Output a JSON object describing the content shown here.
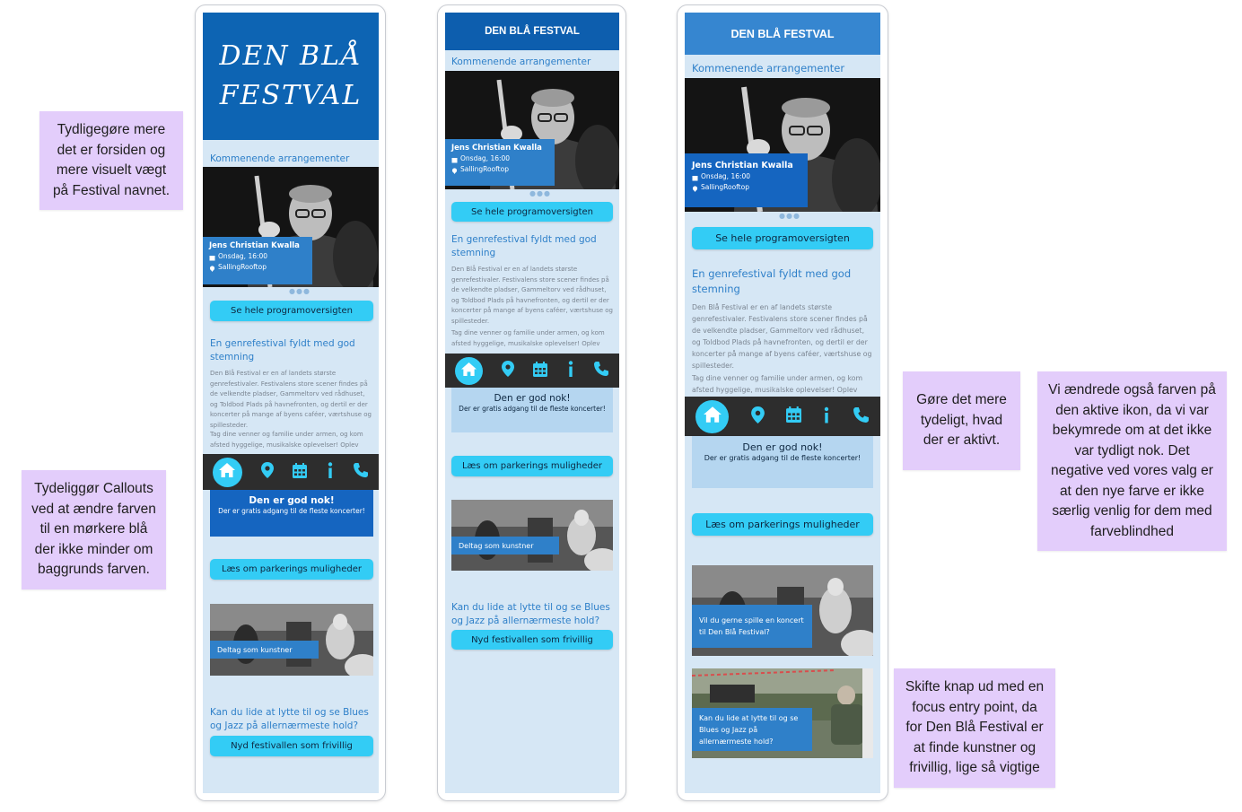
{
  "colors": {
    "header_v1": "#0d64b3",
    "header_v2": "#0d5eae",
    "header_v3": "#3686d0",
    "screen_bg": "#d6e7f5",
    "button": "#33ccf5",
    "callout_dark": "#1565c0",
    "callout_light": "#b5d6f0",
    "nav_bg": "#2d2d2d",
    "nav_icon": "#33ccf5",
    "note_bg": "#e3cdfb"
  },
  "notes": {
    "note1": "Tydligegøre mere det er forsiden og mere visuelt vægt på Festival navnet.",
    "note2": "Tydeliggør Callouts ved at ændre farven til en mørkere blå der ikke minder om baggrunds farven.",
    "note3": "Gøre det mere tydeligt, hvad der er aktivt.",
    "note4": "Vi ændrede også farven på den aktive ikon, da vi var bekymrede om at det ikke var tydligt nok. Det negative ved vores valg er at den nye farve er ikke særlig venlig for dem med farveblindhed",
    "note5": "Skifte knap ud med en focus entry point, da for Den Blå Festival er at finde kunstner og frivillig, lige så vigtige"
  },
  "app": {
    "title_hand_line1": "DEN BLÅ",
    "title_hand_line2": "FESTVAL",
    "title": "DEN BLÅ FESTVAL",
    "section_upcoming": "Kommenende arrangementer",
    "event_name": "Jens Christian Kwalla",
    "event_date": "Onsdag, 16:00",
    "event_place": "SallingRooftop",
    "carousel_dots": "●●●",
    "btn_program": "Se hele programoversigten",
    "heading_genre": "En genrefestival fyldt med god stemning",
    "body_p1": "Den Blå Festival er en af landets største genrefestivaler. Festivalens store scener findes på de velkendte pladser, Gammeltorv ved rådhuset, og Toldbod Plads på havnefronten, og dertil er der koncerter på mange af byens caféer, værtshuse og spillesteder.",
    "body_p2": "Tag dine venner og familie under armen, og kom afsted hyggelige, musikalske oplevelser! Oplev",
    "callout_title": "Den er god nok!",
    "callout_sub": "Der er gratis adgang til de fleste koncerter!",
    "btn_parking": "Læs om parkerings muligheder",
    "artist_label": "Deltag som kunstner",
    "artist_label_v3": "Vil du gerne spille en koncert til Den Blå Festival?",
    "volunteer_question": "Kan du lide at lytte til og se Blues og Jazz på allernærmeste hold?",
    "btn_volunteer": "Nyd festivallen som frivillig",
    "nav": [
      "home-icon",
      "location-icon",
      "calendar-icon",
      "info-icon",
      "phone-icon"
    ]
  }
}
